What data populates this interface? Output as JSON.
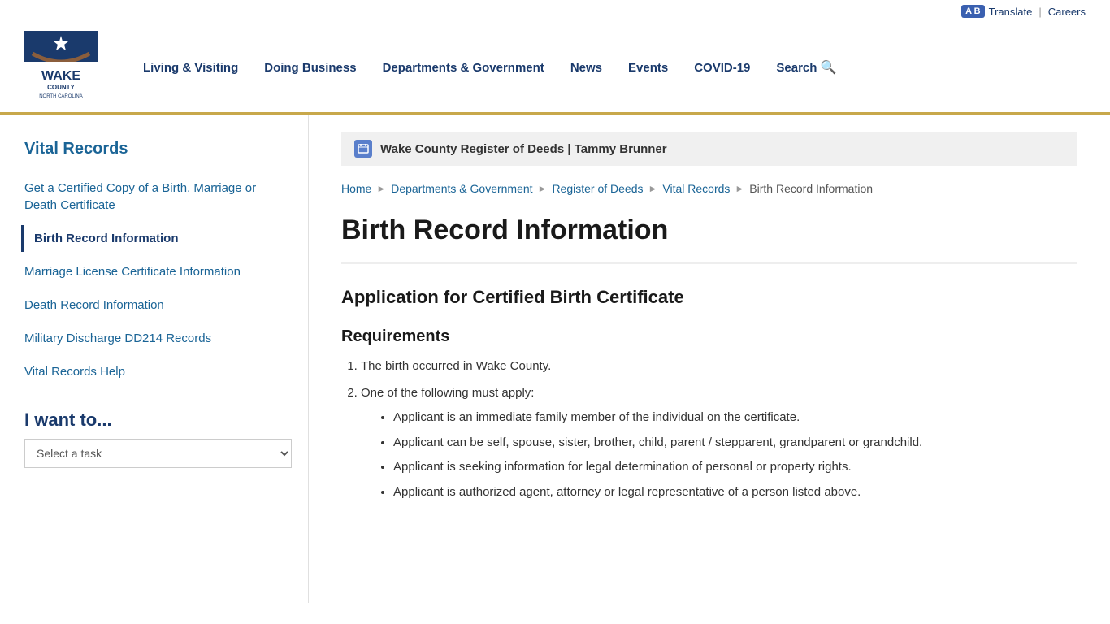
{
  "utility": {
    "translate_label": "Translate",
    "careers_label": "Careers",
    "separator": "|",
    "translate_badge": "A B"
  },
  "nav": {
    "items": [
      {
        "label": "Living & Visiting"
      },
      {
        "label": "Doing Business"
      },
      {
        "label": "Departments & Government"
      },
      {
        "label": "News"
      },
      {
        "label": "Events"
      },
      {
        "label": "COVID-19"
      },
      {
        "label": "Search"
      }
    ]
  },
  "dept_banner": {
    "text": "Wake County Register of Deeds | Tammy Brunner"
  },
  "breadcrumb": {
    "items": [
      {
        "label": "Home",
        "href": "#"
      },
      {
        "label": "Departments & Government",
        "href": "#"
      },
      {
        "label": "Register of Deeds",
        "href": "#"
      },
      {
        "label": "Vital Records",
        "href": "#"
      },
      {
        "label": "Birth Record Information",
        "current": true
      }
    ]
  },
  "page": {
    "title": "Birth Record Information",
    "section1_heading": "Application for Certified Birth Certificate",
    "sub_heading": "Requirements",
    "requirements": [
      "The birth occurred in Wake County.",
      "One of the following must apply:"
    ],
    "bullets": [
      "Applicant is an immediate family member of the individual on the certificate.",
      "Applicant can be self, spouse, sister, brother, child, parent / stepparent, grandparent or grandchild.",
      "Applicant is seeking information for legal determination of personal or property rights.",
      "Applicant is authorized agent, attorney or legal representative of a person listed above."
    ]
  },
  "sidebar": {
    "title": "Vital Records",
    "links": [
      {
        "label": "Get a Certified Copy of a Birth, Marriage or Death Certificate",
        "active": false
      },
      {
        "label": "Birth Record Information",
        "active": true
      },
      {
        "label": "Marriage License Certificate Information",
        "active": false
      },
      {
        "label": "Death Record Information",
        "active": false
      },
      {
        "label": "Military Discharge DD214 Records",
        "active": false
      },
      {
        "label": "Vital Records Help",
        "active": false
      }
    ],
    "i_want": {
      "title": "I want to...",
      "placeholder": "Select a task"
    }
  }
}
